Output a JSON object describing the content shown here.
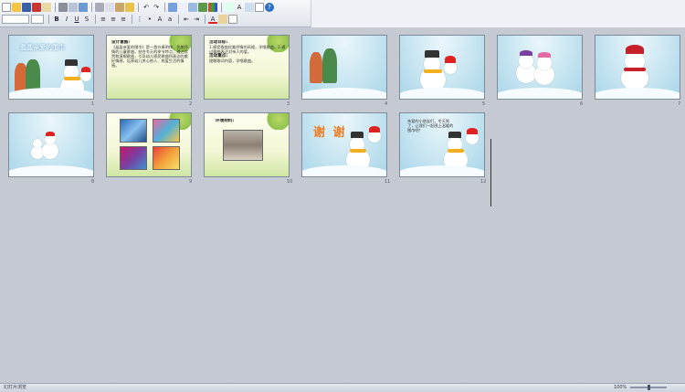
{
  "toolbar": {
    "font_name": "",
    "font_size": ""
  },
  "slides": [
    {
      "num": "1",
      "title": "晶晶亲爱的围巾"
    },
    {
      "num": "2",
      "heading": "设计意图:",
      "text": "《晶晶亲爱的围巾》是一首节奏明快、优美抒情的儿童歌曲。结合冬天的季节特点，通过欣赏和演唱歌曲，引导幼儿感受歌曲所表达的美好情感，培养幼儿关心他人、热爱生活的情感。"
    },
    {
      "num": "3",
      "heading1": "活动目标:",
      "text1": "1.感受歌曲优美抒情的风格，学唱歌曲。2.通过歌曲表达对亲人的爱。",
      "heading2": "活动重点:",
      "text2": "理解歌词内容，学唱歌曲。"
    },
    {
      "num": "4"
    },
    {
      "num": "5"
    },
    {
      "num": "6"
    },
    {
      "num": "7"
    },
    {
      "num": "8"
    },
    {
      "num": "9"
    },
    {
      "num": "10",
      "heading": "环境材料:"
    },
    {
      "num": "11",
      "big": "谢 谢"
    },
    {
      "num": "12",
      "text": "亲爱的小朋友们，冬天到了，让我们一起围上温暖的围巾吧！"
    }
  ],
  "status": {
    "view": "幻灯片浏览",
    "theme": "",
    "zoom": "100%"
  }
}
